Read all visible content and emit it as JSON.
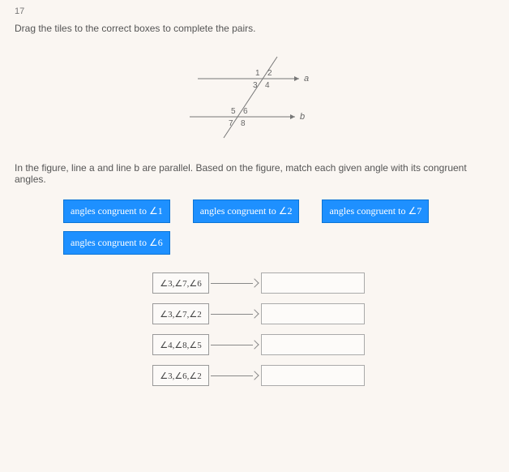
{
  "question_number": "17",
  "instruction": "Drag the tiles to the correct boxes to complete the pairs.",
  "figure": {
    "labels": {
      "a1": "1",
      "a2": "2",
      "a3": "3",
      "a4": "4",
      "a5": "5",
      "a6": "6",
      "a7": "7",
      "a8": "8",
      "lineA": "a",
      "lineB": "b"
    }
  },
  "explanation_text": "In the figure, line a and line b are parallel. Based on the figure, match each given angle with its congruent angles.",
  "tiles": {
    "t1": "angles congruent to ∠1",
    "t2": "angles congruent to ∠2",
    "t7": "angles congruent to ∠7",
    "t6": "angles congruent to ∠6"
  },
  "pairs": [
    {
      "left": "∠3,∠7,∠6"
    },
    {
      "left": "∠3,∠7,∠2"
    },
    {
      "left": "∠4,∠8,∠5"
    },
    {
      "left": "∠3,∠6,∠2"
    }
  ]
}
